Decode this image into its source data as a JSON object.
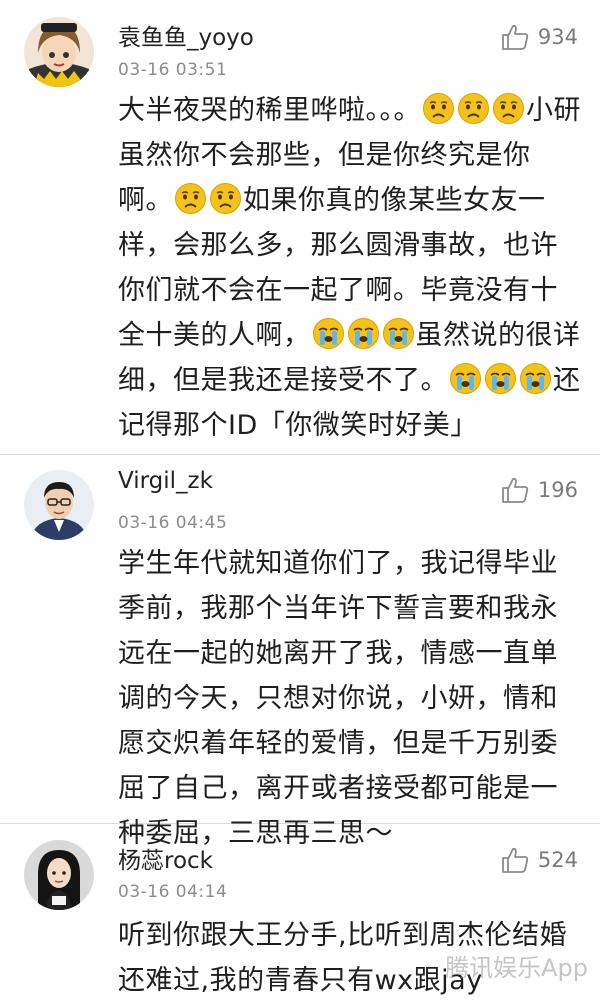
{
  "comments": [
    {
      "username": "袁鱼鱼_yoyo",
      "time": "03-16 03:51",
      "likes": "934",
      "avatar_icon": "cartoon-girl-avatar",
      "text": {
        "s1": "大半夜哭的稀里哗啦。。。",
        "s2": "小研虽然你不会那些，但是你终究是你啊。",
        "s3": "如果你真的像某些女友一样，会那么多，那么圆滑事故，也许你们就不会在一起了啊。毕竟没有十全十美的人啊，",
        "s4": "虽然说的很详细，但是我还是接受不了。",
        "s5": "还记得那个ID「你微笑时好美」"
      }
    },
    {
      "username": "Virgil_zk",
      "time": "03-16 04:45",
      "likes": "196",
      "avatar_icon": "man-with-glasses-avatar",
      "text": "学生年代就知道你们了，我记得毕业季前，我那个当年许下誓言要和我永远在一起的她离开了我，情感一直单调的今天，只想对你说，小妍，情和愿交炽着年轻的爱情，但是千万别委屈了自己，离开或者接受都可能是一种委屈，三思再三思～"
    },
    {
      "username": "杨蕊rock",
      "time": "03-16 04:14",
      "likes": "524",
      "avatar_icon": "woman-dark-hair-avatar",
      "text": "听到你跟大王分手,比听到周杰伦结婚还难过,我的青春只有wx跟jay"
    }
  ],
  "icons": {
    "like": "thumbs-up-icon",
    "sad": "sad-face-emoji",
    "cry": "crying-face-emoji"
  },
  "colors": {
    "text": "#1f1f1f",
    "meta": "#8c8c8c",
    "divider": "#dcdcdc",
    "emoji": "#f5c21b"
  },
  "watermark": "腾讯娱乐App"
}
